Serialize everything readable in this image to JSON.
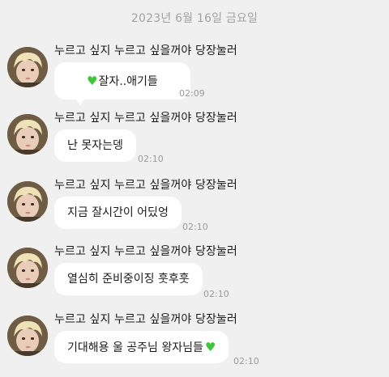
{
  "date_header": "2023년 6월 16일 금요일",
  "colors": {
    "background": "#f0f0f0",
    "bubble": "#ffffff",
    "heart": "#3fc53a",
    "timestamp": "#9a9a9a"
  },
  "messages": [
    {
      "sender": "누르고 싶지 누르고 싶을꺼야 당장눌러",
      "text": "잘자..애기들",
      "emoji": "green-heart",
      "emoji_position": "before",
      "time": "02:09"
    },
    {
      "sender": "누르고 싶지 누르고 싶을꺼야 당장눌러",
      "text": "난 못자는뎅",
      "time": "02:10"
    },
    {
      "sender": "누르고 싶지 누르고 싶을꺼야 당장눌러",
      "text": "지금 잘시간이 어딨엉",
      "time": "02:10"
    },
    {
      "sender": "누르고 싶지 누르고 싶을꺼야 당장눌러",
      "text": "열심히 준비중이징 훗후훗",
      "time": "02:10"
    },
    {
      "sender": "누르고 싶지 누르고 싶을꺼야 당장눌러",
      "text": "기대해용 울 공주님 왕자님들",
      "emoji": "green-heart",
      "emoji_position": "after",
      "time": "02:10"
    }
  ]
}
